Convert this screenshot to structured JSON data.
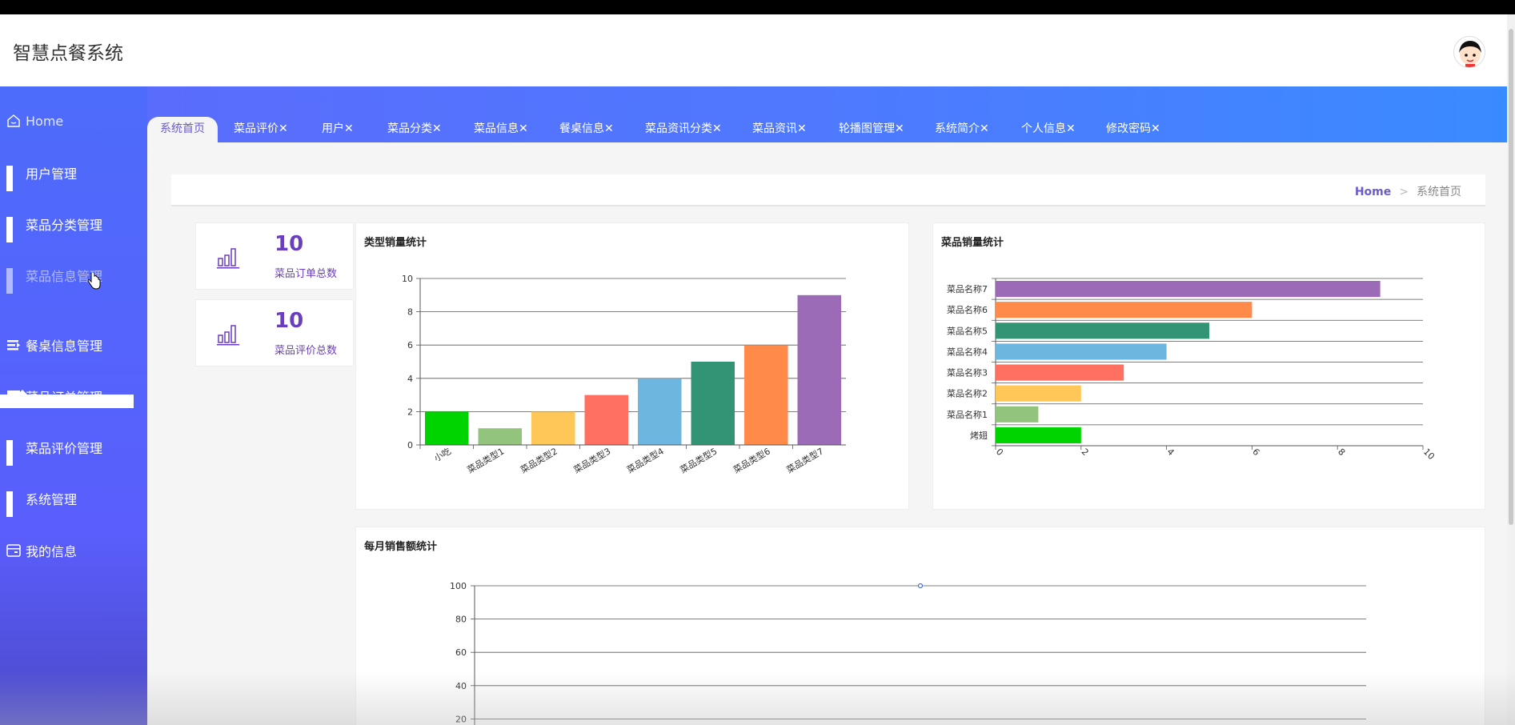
{
  "app": {
    "title": "智慧点餐系统"
  },
  "sidebar": {
    "items": [
      {
        "label": "Home",
        "icon": "home-icon"
      },
      {
        "label": "用户管理",
        "icon": "grid-icon"
      },
      {
        "label": "菜品分类管理",
        "icon": "grid-icon"
      },
      {
        "label": "菜品信息管理",
        "icon": "grid-icon"
      },
      {
        "label": "餐桌信息管理",
        "icon": "list-icon"
      },
      {
        "label": "菜品订单管理",
        "icon": "monitor-icon"
      },
      {
        "label": "菜品评价管理",
        "icon": "grid-icon"
      },
      {
        "label": "系统管理",
        "icon": "grid-icon"
      },
      {
        "label": "我的信息",
        "icon": "card-icon"
      }
    ]
  },
  "tabs": [
    {
      "label": "系统首页"
    },
    {
      "label": "菜品评价✕"
    },
    {
      "label": "用户✕"
    },
    {
      "label": "菜品分类✕"
    },
    {
      "label": "菜品信息✕"
    },
    {
      "label": "餐桌信息✕"
    },
    {
      "label": "菜品资讯分类✕"
    },
    {
      "label": "菜品资讯✕"
    },
    {
      "label": "轮播图管理✕"
    },
    {
      "label": "系统简介✕"
    },
    {
      "label": "个人信息✕"
    },
    {
      "label": "修改密码✕"
    }
  ],
  "breadcrumb": {
    "home": "Home",
    "sep": ">",
    "current": "系统首页"
  },
  "stats": [
    {
      "value": "10",
      "label": "菜品订单总数"
    },
    {
      "value": "10",
      "label": "菜品评价总数"
    }
  ],
  "panels": {
    "type_sales": "类型销量统计",
    "dish_sales": "菜品销量统计",
    "monthly_sales": "每月销售额统计"
  },
  "colors": {
    "accent": "#6a3fbf",
    "palette": [
      "#00d400",
      "#93c47d",
      "#ffc658",
      "#ff7061",
      "#6cb6e0",
      "#329474",
      "#ff8a4a",
      "#9c6bb8"
    ]
  },
  "chart_data": [
    {
      "type": "bar",
      "title": "类型销量统计",
      "categories": [
        "小吃",
        "菜品类型1",
        "菜品类型2",
        "菜品类型3",
        "菜品类型4",
        "菜品类型5",
        "菜品类型6",
        "菜品类型7"
      ],
      "values": [
        2,
        1,
        2,
        3,
        4,
        5,
        6,
        9
      ],
      "ylim": [
        0,
        10
      ],
      "yticks": [
        "0",
        "2",
        "4",
        "6",
        "8",
        "10"
      ],
      "grid": true
    },
    {
      "type": "bar",
      "orientation": "horizontal",
      "title": "菜品销量统计",
      "categories": [
        "烤翅",
        "菜品名称1",
        "菜品名称2",
        "菜品名称3",
        "菜品名称4",
        "菜品名称5",
        "菜品名称6",
        "菜品名称7"
      ],
      "values": [
        2,
        1,
        2,
        3,
        4,
        5,
        6,
        9
      ],
      "xlim": [
        0,
        10
      ],
      "xticks": [
        "0",
        "2",
        "4",
        "6",
        "8",
        "10"
      ],
      "grid": true
    },
    {
      "type": "line",
      "title": "每月销售额统计",
      "ylim": [
        0,
        100
      ],
      "yticks": [
        "20",
        "40",
        "60",
        "80",
        "100"
      ],
      "points": [
        {
          "y": 100
        }
      ],
      "grid": true
    }
  ]
}
